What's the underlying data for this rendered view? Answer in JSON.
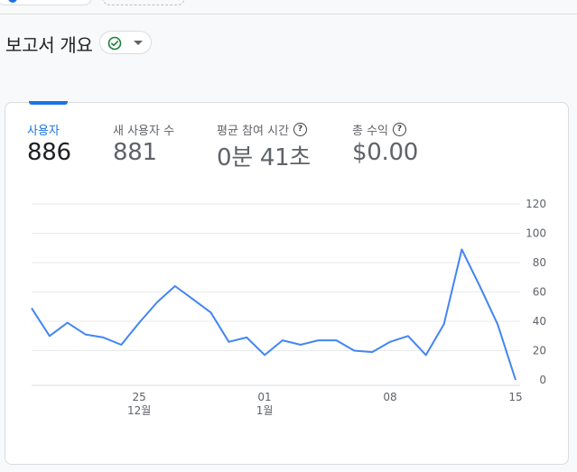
{
  "header": {
    "title": "보고서 개요"
  },
  "metrics": [
    {
      "label": "사용자",
      "value": "886",
      "help": false
    },
    {
      "label": "새 사용자 수",
      "value": "881",
      "help": false
    },
    {
      "label": "평균 참여 시간",
      "value": "0분 41초",
      "help": true
    },
    {
      "label": "총 수익",
      "value": "$0.00",
      "help": true
    }
  ],
  "colors": {
    "accent": "#1a73e8",
    "line": "#4285f4",
    "ok": "#188038",
    "grid": "#e8eaed"
  },
  "chart_data": {
    "type": "line",
    "ylim": [
      0,
      120
    ],
    "y_ticks": [
      0,
      20,
      40,
      60,
      80,
      100,
      120
    ],
    "x_ticks": [
      {
        "index": 6,
        "day": "25",
        "month": "12월"
      },
      {
        "index": 13,
        "day": "01",
        "month": "1월"
      },
      {
        "index": 20,
        "day": "08",
        "month": ""
      },
      {
        "index": 27,
        "day": "15",
        "month": ""
      }
    ],
    "series": [
      {
        "values": [
          49,
          30,
          39,
          31,
          29,
          24,
          39,
          53,
          64,
          55,
          46,
          26,
          29,
          17,
          27,
          24,
          27,
          27,
          20,
          19,
          26,
          30,
          17,
          38,
          89,
          64,
          38,
          0
        ]
      }
    ]
  }
}
